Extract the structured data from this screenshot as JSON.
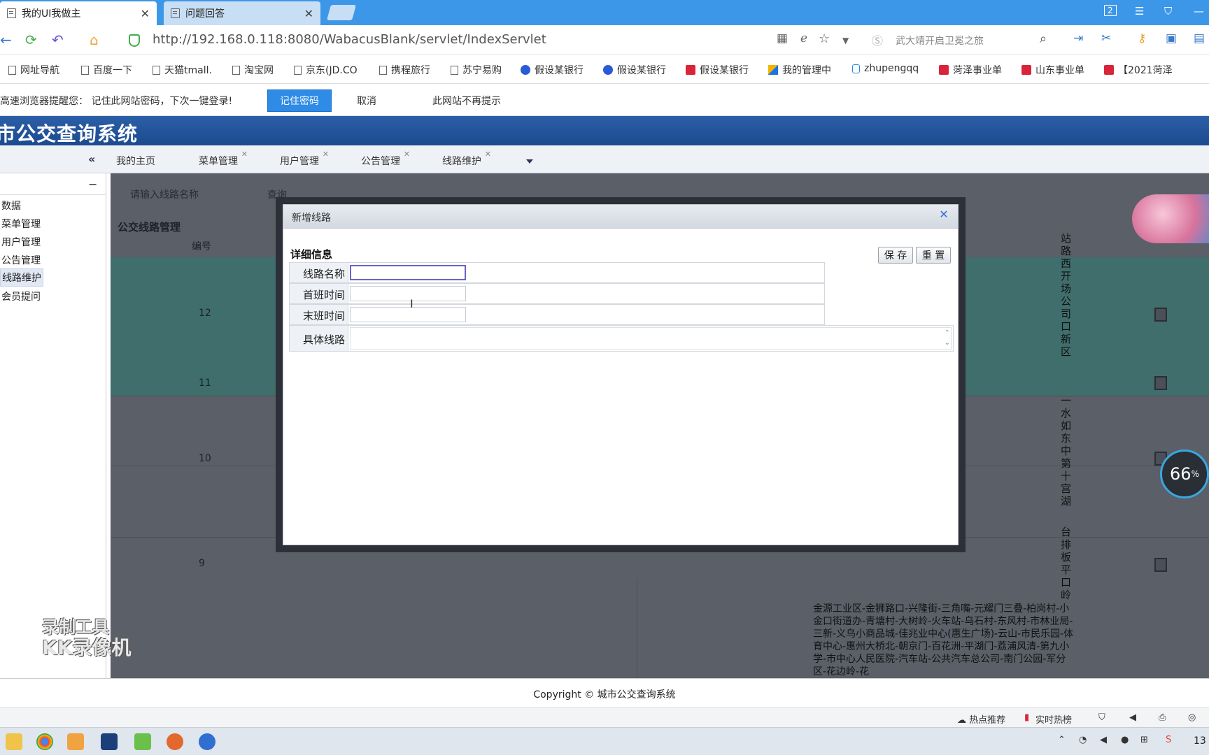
{
  "browser": {
    "tabs": [
      {
        "label": "我的UI我做主",
        "active": true
      },
      {
        "label": "问题回答",
        "active": false
      }
    ],
    "tab_count": "2",
    "url": "http://192.168.0.118:8080/WabacusBlank/servlet/IndexServlet",
    "search_hint": "武大靖开启卫冕之旅",
    "bookmarks": [
      "网址导航",
      "百度一下",
      "天猫tmall.",
      "淘宝网",
      "京东(JD.CO",
      "携程旅行",
      "苏宁易购",
      "假设某银行",
      "假设某银行",
      "假设某银行",
      "我的管理中",
      "zhupengqq",
      "菏泽事业单",
      "山东事业单",
      "【2021菏泽"
    ],
    "password_prompt": {
      "message": "高速浏览器提醒您：  记住此网站密码，下次一键登录!",
      "save": "记住密码",
      "cancel": "取消",
      "never": "此网站不再提示"
    }
  },
  "app": {
    "title": "市公交查询系统",
    "tabs": [
      "我的主页",
      "菜单管理",
      "用户管理",
      "公告管理",
      "线路维护"
    ],
    "sidebar": [
      "数据",
      "菜单管理",
      "用户管理",
      "公告管理",
      "线路维护",
      "会员提问"
    ],
    "query_placeholder": "请输入线路名称",
    "query_button": "查询",
    "grid_title": "公交线路管理",
    "col_id": "编号",
    "rows": [
      "12",
      "11",
      "10",
      "9"
    ],
    "route_text": "金源工业区-金狮路口-兴隆街-三角嘴-元耀门三叠-柏岗村-小金口街道办-青塘村-大树岭-火车站-乌石村-东风村-市林业局-三新-义乌小商品城-佳兆业中心(惠生广场)-云山-市民乐园-体育中心-惠州大桥北-朝京门-百花洲-平湖门-荔浦风清-第九小学-市中心人民医院-汽车站-公共汽车总公司-南门公园-军分区-花边岭-花",
    "vert_texts": [
      "站路西开场公司口新区",
      "一水如东中第十宫湖",
      "台排板平口岭"
    ],
    "percent": "66",
    "percent_unit": "%",
    "watermark_1": "录制工具",
    "watermark_2": "KK录像机",
    "copyright": "Copyright © 城市公交查询系统"
  },
  "modal": {
    "title": "新增线路",
    "section": "详细信息",
    "save": "保 存",
    "reset": "重 置",
    "fields": {
      "name_label": "线路名称",
      "first_label": "首班时间",
      "last_label": "末班时间",
      "route_label": "具体线路"
    }
  },
  "status": {
    "hot": "热点推荐",
    "realtime": "实时热榜",
    "time": "13"
  },
  "colors": {
    "tabbar": "#3d97e8",
    "header": "#1c4a8e",
    "accent": "#2e8be6"
  }
}
